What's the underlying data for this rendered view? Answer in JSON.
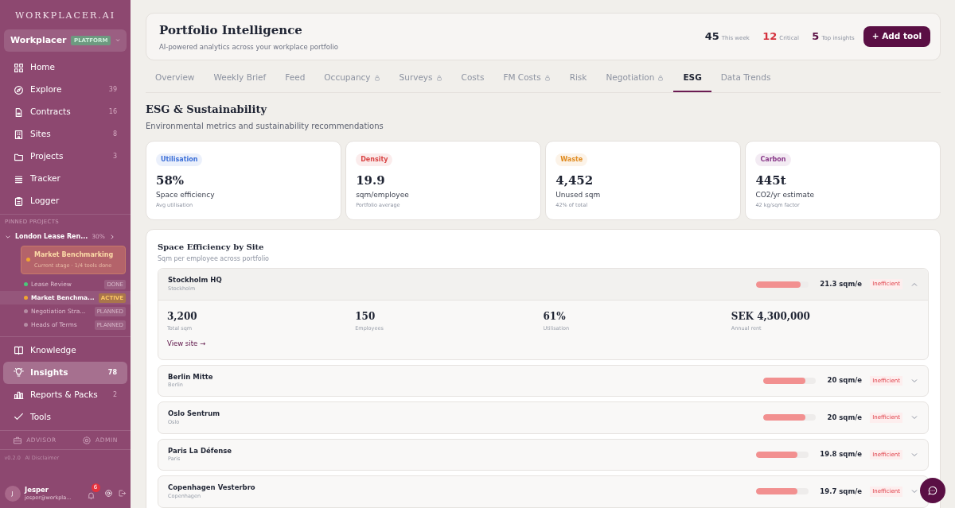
{
  "sidebar": {
    "logo": "WORKPLACER.AI",
    "workspace": {
      "name": "Workplacer",
      "badge": "PLATFORM"
    },
    "nav": [
      {
        "label": "Home",
        "selected": false
      },
      {
        "label": "Explore",
        "count": "39",
        "selected": false
      },
      {
        "label": "Contracts",
        "count": "16",
        "selected": false
      },
      {
        "label": "Sites",
        "count": "8",
        "selected": false
      },
      {
        "label": "Projects",
        "count": "3",
        "selected": false
      },
      {
        "label": "Tracker",
        "selected": false
      },
      {
        "label": "Logger",
        "selected": false
      }
    ],
    "pinned_heading": "PINNED PROJECTS",
    "pinned": {
      "name": "London Lease Ren...",
      "progress": "30%",
      "expanded": true,
      "stage": {
        "title": "Market Benchmarking",
        "subtitle": "Current stage · 1/4 tools done"
      },
      "steps": [
        {
          "label": "Lease Review",
          "badge": "DONE",
          "color": "#4cc77a",
          "selected": false
        },
        {
          "label": "Market Benchma...",
          "badge": "ACTIVE",
          "color": "#f0a531",
          "selected": true
        },
        {
          "label": "Negotiation Stra...",
          "badge": "PLANNED",
          "color": "#b58ba3",
          "selected": false
        },
        {
          "label": "Heads of Terms",
          "badge": "PLANNED",
          "color": "#b58ba3",
          "selected": false
        }
      ]
    },
    "nav2": [
      {
        "label": "Knowledge",
        "selected": false
      },
      {
        "label": "Insights",
        "count": "78",
        "selected": true
      },
      {
        "label": "Reports & Packs",
        "count": "2",
        "selected": false
      },
      {
        "label": "Tools",
        "selected": false
      }
    ],
    "modes": [
      {
        "label": "ADVISOR",
        "selected": false
      },
      {
        "label": "ADMIN",
        "selected": false
      }
    ],
    "version": "v0.2.0",
    "disclaimer": "AI Disclaimer",
    "user": {
      "initial": "J",
      "name": "Jesper",
      "email": "jesper@workpla...",
      "notifications": "6"
    }
  },
  "header": {
    "title": "Portfolio Intelligence",
    "subtitle": "AI-powered analytics across your workplace portfolio",
    "stats": [
      {
        "value": "45",
        "label": "This week",
        "kind": "normal"
      },
      {
        "value": "12",
        "label": "Critical",
        "kind": "critical"
      },
      {
        "value": "5",
        "label": "Top insights",
        "kind": "accent"
      }
    ],
    "button": "+ Add tool"
  },
  "tabs": [
    {
      "label": "Overview",
      "locked": false,
      "selected": false
    },
    {
      "label": "Weekly Brief",
      "locked": false,
      "selected": false
    },
    {
      "label": "Feed",
      "locked": false,
      "selected": false
    },
    {
      "label": "Occupancy",
      "locked": true,
      "selected": false
    },
    {
      "label": "Surveys",
      "locked": true,
      "selected": false
    },
    {
      "label": "Costs",
      "locked": false,
      "selected": false
    },
    {
      "label": "FM Costs",
      "locked": true,
      "selected": false
    },
    {
      "label": "Risk",
      "locked": false,
      "selected": false
    },
    {
      "label": "Negotiation",
      "locked": true,
      "selected": false
    },
    {
      "label": "ESG",
      "locked": false,
      "selected": true
    },
    {
      "label": "Data Trends",
      "locked": false,
      "selected": false
    }
  ],
  "section": {
    "title": "ESG & Sustainability",
    "subtitle": "Environmental metrics and sustainability recommendations"
  },
  "kpis": [
    {
      "tag": "Utilisation",
      "color": "#3b6fd8",
      "value": "58%",
      "label": "Space efficiency",
      "note": "Avg utilisation"
    },
    {
      "tag": "Density",
      "color": "#d94545",
      "value": "19.9",
      "label": "sqm/employee",
      "note": "Portfolio average"
    },
    {
      "tag": "Waste",
      "color": "#e08a1e",
      "value": "4,452",
      "label": "Unused sqm",
      "note": "42% of total"
    },
    {
      "tag": "Carbon",
      "color": "#8a3a8a",
      "value": "445t",
      "label": "CO2/yr estimate",
      "note": "42 kg/sqm factor"
    }
  ],
  "panel": {
    "title": "Space Efficiency by Site",
    "subtitle": "Sqm per employee across portfolio",
    "sites": [
      {
        "name": "Stockholm HQ",
        "city": "Stockholm",
        "level": 0.85,
        "reading": "21.3 sqm/e",
        "status": "Inefficient",
        "expanded": true,
        "details": [
          {
            "value": "3,200",
            "label": "Total sqm"
          },
          {
            "value": "150",
            "label": "Employees"
          },
          {
            "value": "61%",
            "label": "Utilisation"
          },
          {
            "value": "SEK 4,300,000",
            "label": "Annual rent"
          }
        ],
        "link": "View site →"
      },
      {
        "name": "Berlin Mitte",
        "city": "Berlin",
        "level": 0.8,
        "reading": "20 sqm/e",
        "status": "Inefficient",
        "expanded": false
      },
      {
        "name": "Oslo Sentrum",
        "city": "Oslo",
        "level": 0.8,
        "reading": "20 sqm/e",
        "status": "Inefficient",
        "expanded": false
      },
      {
        "name": "Paris La Défense",
        "city": "Paris",
        "level": 0.78,
        "reading": "19.8 sqm/e",
        "status": "Inefficient",
        "expanded": false
      },
      {
        "name": "Copenhagen Vesterbro",
        "city": "Copenhagen",
        "level": 0.78,
        "reading": "19.7 sqm/e",
        "status": "Inefficient",
        "expanded": false
      }
    ]
  }
}
